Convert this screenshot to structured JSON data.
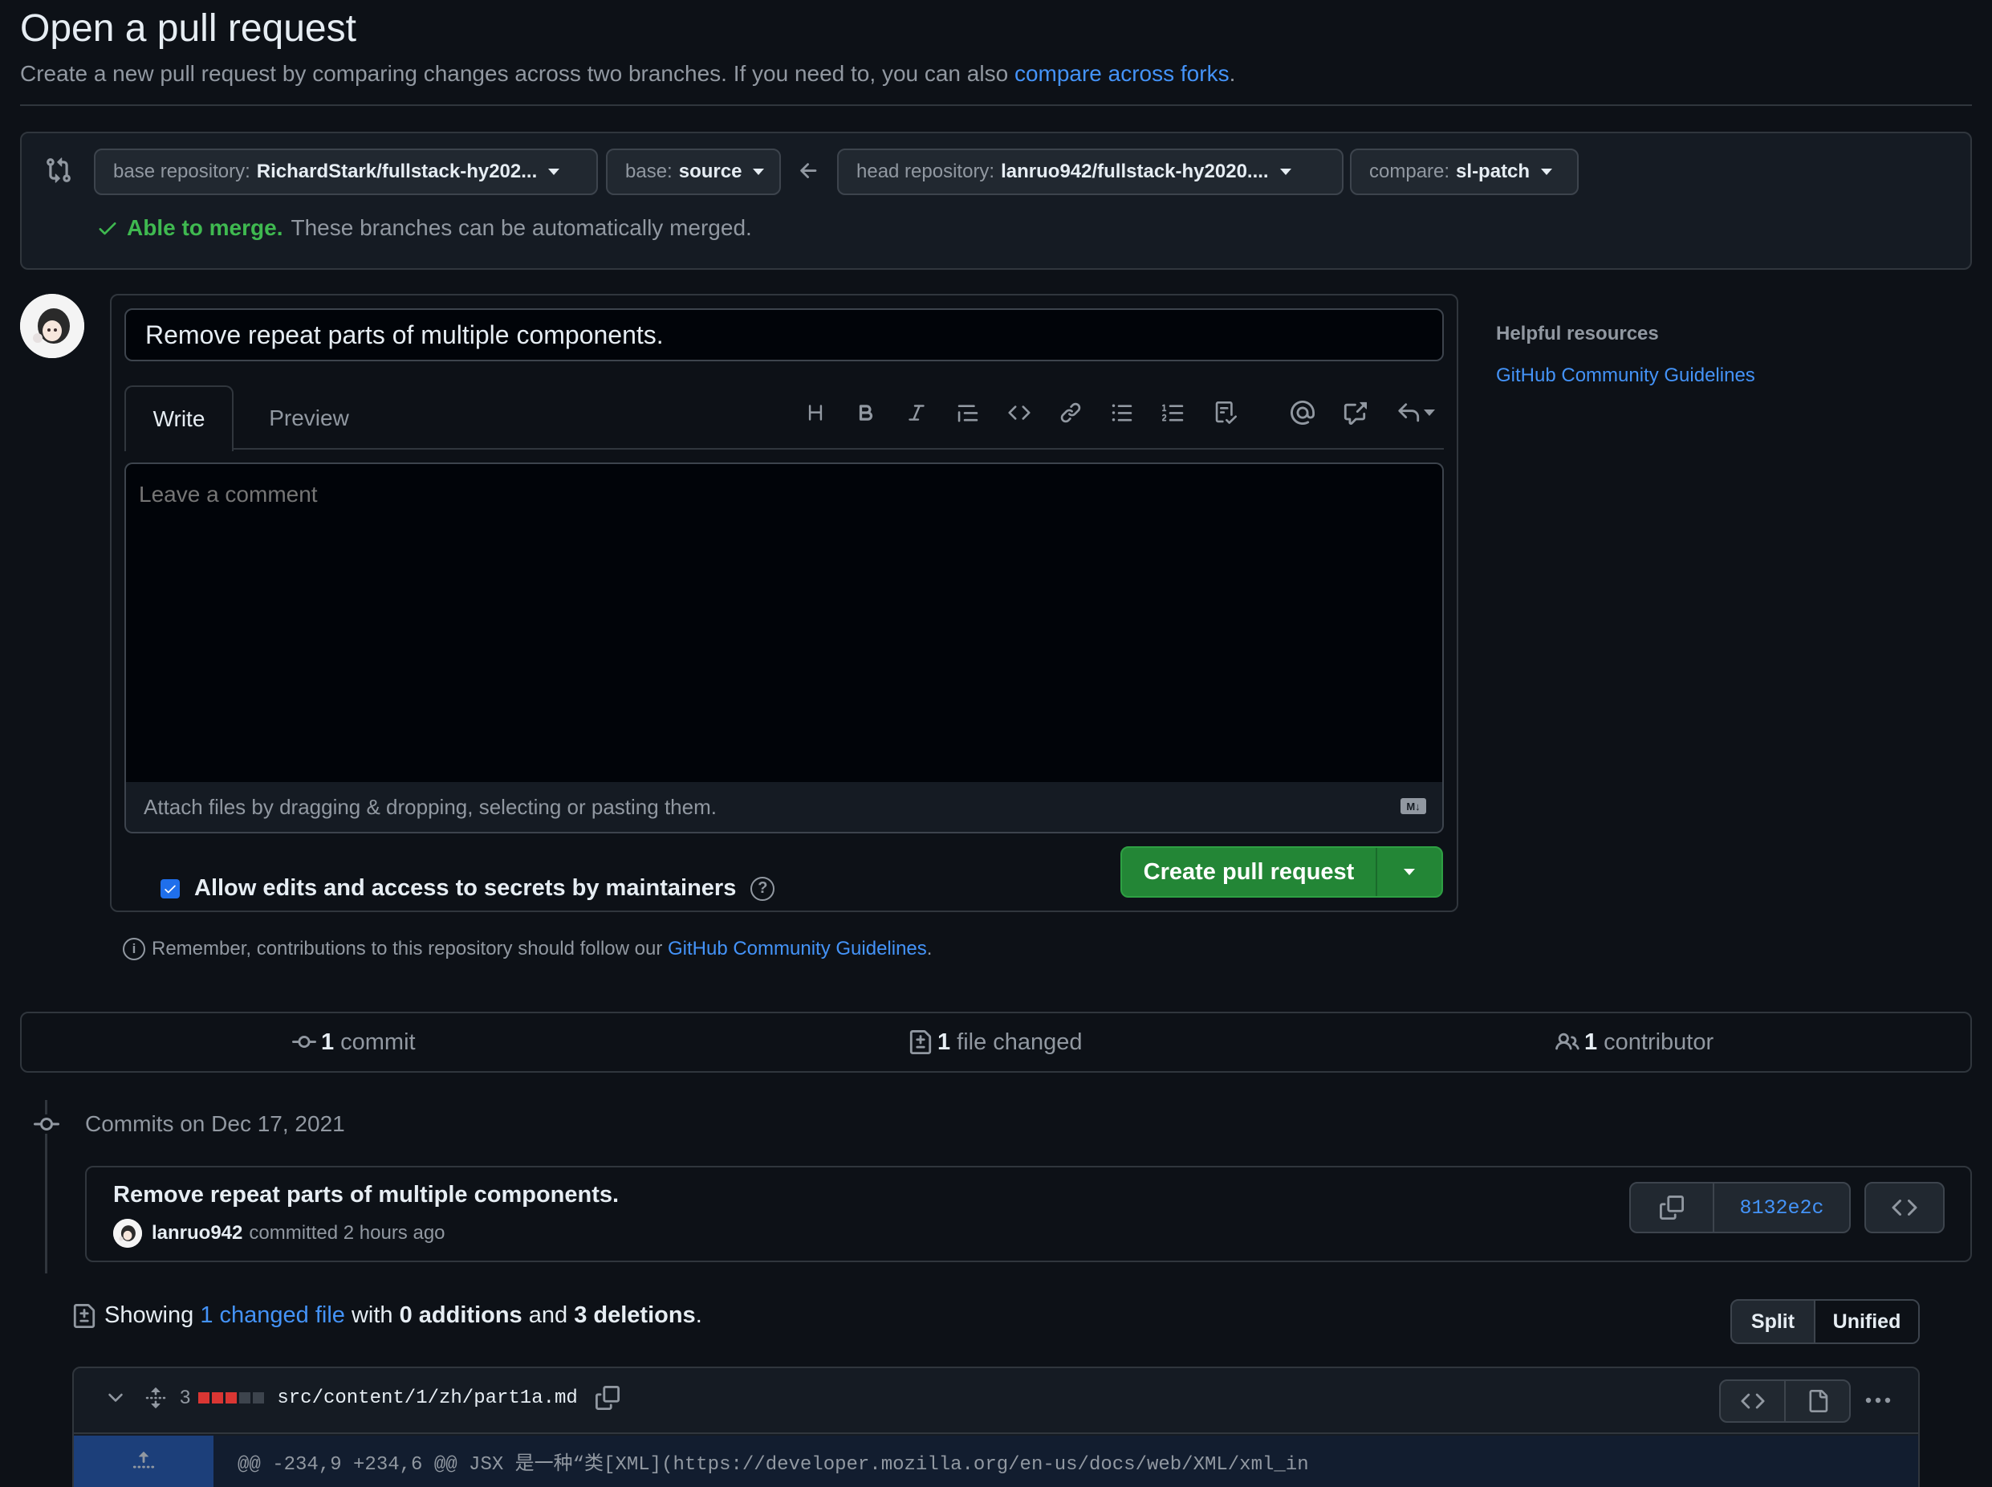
{
  "header": {
    "title": "Open a pull request",
    "subtitle_text": "Create a new pull request by comparing changes across two branches. If you need to, you can also",
    "subtitle_link": "compare across forks",
    "subtitle_end": "."
  },
  "compare": {
    "base_repo_label": "base repository:",
    "base_repo_value": "RichardStark/fullstack-hy202...",
    "base_label": "base:",
    "base_value": "source",
    "head_repo_label": "head repository:",
    "head_repo_value": "lanruo942/fullstack-hy2020....",
    "compare_label": "compare:",
    "compare_value": "sl-patch",
    "merge_status": "Able to merge.",
    "merge_message": "These branches can be automatically merged."
  },
  "form": {
    "title_value": "Remove repeat parts of multiple components.",
    "tabs": [
      "Write",
      "Preview"
    ],
    "comment_placeholder": "Leave a comment",
    "attach_text": "Attach files by dragging & dropping, selecting or pasting them.",
    "markdown_badge": "M↓",
    "allow_edits_label": "Allow edits and access to secrets by maintainers",
    "allow_edits_checked": true,
    "create_button": "Create pull request"
  },
  "toolbar": {
    "icons": [
      "heading-icon",
      "bold-icon",
      "italic-icon",
      "quote-icon",
      "code-icon",
      "link-icon",
      "unordered-list-icon",
      "ordered-list-icon",
      "task-list-icon",
      "mention-icon",
      "cross-reference-icon",
      "saved-replies-icon"
    ]
  },
  "remember": {
    "text": "Remember, contributions to this repository should follow our",
    "link": "GitHub Community Guidelines",
    "end": "."
  },
  "sidebar": {
    "heading": "Helpful resources",
    "link": "GitHub Community Guidelines"
  },
  "summary": {
    "commits_count": "1",
    "commits_label": "commit",
    "files_count": "1",
    "files_label": "file changed",
    "contributors_count": "1",
    "contributors_label": "contributor"
  },
  "commits": {
    "date_heading": "Commits on Dec 17, 2021",
    "items": [
      {
        "message": "Remove repeat parts of multiple components.",
        "author": "lanruo942",
        "meta": "committed 2 hours ago",
        "sha": "8132e2c"
      }
    ]
  },
  "diff_summary": {
    "showing": "Showing",
    "changed_files_link": "1 changed file",
    "with": "with",
    "additions": "0 additions",
    "and": "and",
    "deletions": "3 deletions",
    "end": ".",
    "view_split": "Split",
    "view_unified": "Unified"
  },
  "file": {
    "change_count": "3",
    "deleted_blocks": 3,
    "neutral_blocks": 2,
    "path": "src/content/1/zh/part1a.md",
    "hunk_header": "@@ -234,9 +234,6 @@ JSX 是一种“类[XML](https://developer.mozilla.org/en-us/docs/web/XML/xml_in"
  },
  "colors": {
    "background": "#0d1117",
    "accent_link": "#4493f8",
    "success": "#3fb950",
    "primary_button": "#238636",
    "deletion": "#da3633"
  }
}
